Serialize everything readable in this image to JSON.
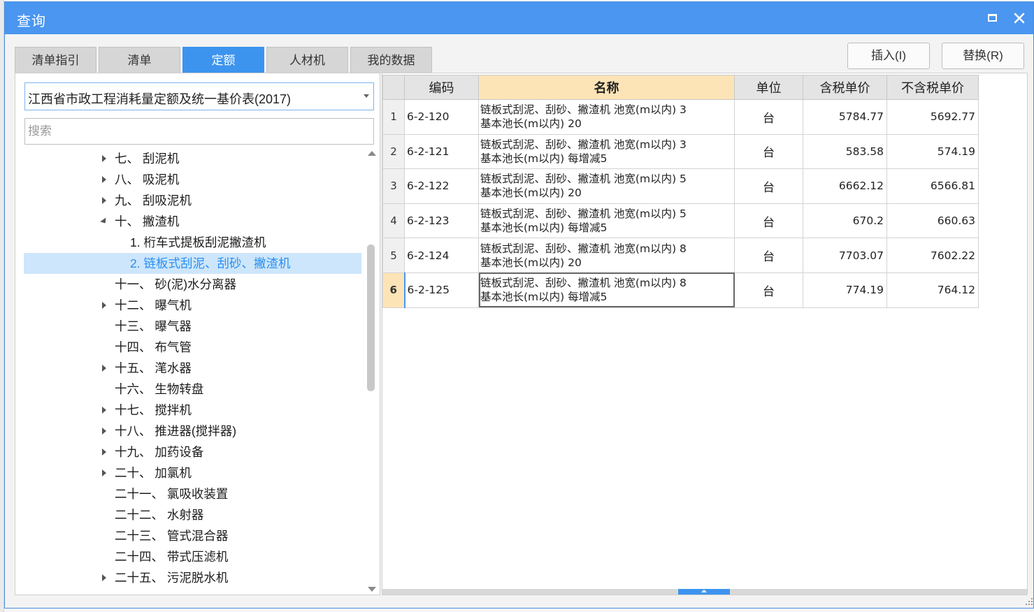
{
  "window": {
    "title": "查询"
  },
  "tabs": [
    {
      "label": "清单指引",
      "active": false
    },
    {
      "label": "清单",
      "active": false
    },
    {
      "label": "定额",
      "active": true
    },
    {
      "label": "人材机",
      "active": false
    },
    {
      "label": "我的数据",
      "active": false
    }
  ],
  "actions": {
    "insert_label": "插入(I)",
    "replace_label": "替换(R)"
  },
  "library": {
    "selected": "江西省市政工程消耗量定额及统一基价表(2017)"
  },
  "search": {
    "placeholder": "搜索",
    "value": ""
  },
  "tree": [
    {
      "label": "七、 刮泥机",
      "expandable": true,
      "expanded": false,
      "level": 0,
      "selected": false
    },
    {
      "label": "八、 吸泥机",
      "expandable": true,
      "expanded": false,
      "level": 0,
      "selected": false
    },
    {
      "label": "九、 刮吸泥机",
      "expandable": true,
      "expanded": false,
      "level": 0,
      "selected": false
    },
    {
      "label": "十、 撇渣机",
      "expandable": true,
      "expanded": true,
      "level": 0,
      "selected": false
    },
    {
      "label": "1. 桁车式提板刮泥撇渣机",
      "expandable": false,
      "expanded": false,
      "level": 1,
      "selected": false
    },
    {
      "label": "2. 链板式刮泥、刮砂、撇渣机",
      "expandable": false,
      "expanded": false,
      "level": 1,
      "selected": true
    },
    {
      "label": "十一、 砂(泥)水分离器",
      "expandable": false,
      "expanded": false,
      "level": 0,
      "selected": false
    },
    {
      "label": "十二、 曝气机",
      "expandable": true,
      "expanded": false,
      "level": 0,
      "selected": false
    },
    {
      "label": "十三、 曝气器",
      "expandable": false,
      "expanded": false,
      "level": 0,
      "selected": false
    },
    {
      "label": "十四、 布气管",
      "expandable": false,
      "expanded": false,
      "level": 0,
      "selected": false
    },
    {
      "label": "十五、 滗水器",
      "expandable": true,
      "expanded": false,
      "level": 0,
      "selected": false
    },
    {
      "label": "十六、 生物转盘",
      "expandable": false,
      "expanded": false,
      "level": 0,
      "selected": false
    },
    {
      "label": "十七、 搅拌机",
      "expandable": true,
      "expanded": false,
      "level": 0,
      "selected": false
    },
    {
      "label": "十八、 推进器(搅拌器)",
      "expandable": true,
      "expanded": false,
      "level": 0,
      "selected": false
    },
    {
      "label": "十九、 加药设备",
      "expandable": true,
      "expanded": false,
      "level": 0,
      "selected": false
    },
    {
      "label": "二十、 加氯机",
      "expandable": true,
      "expanded": false,
      "level": 0,
      "selected": false
    },
    {
      "label": "二十一、 氯吸收装置",
      "expandable": false,
      "expanded": false,
      "level": 0,
      "selected": false
    },
    {
      "label": "二十二、 水射器",
      "expandable": false,
      "expanded": false,
      "level": 0,
      "selected": false
    },
    {
      "label": "二十三、 管式混合器",
      "expandable": false,
      "expanded": false,
      "level": 0,
      "selected": false
    },
    {
      "label": "二十四、 带式压滤机",
      "expandable": false,
      "expanded": false,
      "level": 0,
      "selected": false
    },
    {
      "label": "二十五、 污泥脱水机",
      "expandable": true,
      "expanded": false,
      "level": 0,
      "selected": false
    }
  ],
  "grid": {
    "columns": [
      "",
      "编码",
      "名称",
      "单位",
      "含税单价",
      "不含税单价"
    ],
    "active_row": 6,
    "rows": [
      {
        "no": "1",
        "code": "6-2-120",
        "name_line1": "链板式刮泥、刮砂、撇渣机 池宽(m以内) 3",
        "name_line2": "基本池长(m以内) 20",
        "unit": "台",
        "price_tax": "5784.77",
        "price_notax": "5692.77"
      },
      {
        "no": "2",
        "code": "6-2-121",
        "name_line1": "链板式刮泥、刮砂、撇渣机 池宽(m以内) 3",
        "name_line2": "基本池长(m以内) 每增减5",
        "unit": "台",
        "price_tax": "583.58",
        "price_notax": "574.19"
      },
      {
        "no": "3",
        "code": "6-2-122",
        "name_line1": "链板式刮泥、刮砂、撇渣机 池宽(m以内) 5",
        "name_line2": "基本池长(m以内) 20",
        "unit": "台",
        "price_tax": "6662.12",
        "price_notax": "6566.81"
      },
      {
        "no": "4",
        "code": "6-2-123",
        "name_line1": "链板式刮泥、刮砂、撇渣机 池宽(m以内) 5",
        "name_line2": "基本池长(m以内) 每增减5",
        "unit": "台",
        "price_tax": "670.2",
        "price_notax": "660.63"
      },
      {
        "no": "5",
        "code": "6-2-124",
        "name_line1": "链板式刮泥、刮砂、撇渣机 池宽(m以内) 8",
        "name_line2": "基本池长(m以内) 20",
        "unit": "台",
        "price_tax": "7703.07",
        "price_notax": "7602.22"
      },
      {
        "no": "6",
        "code": "6-2-125",
        "name_line1": "链板式刮泥、刮砂、撇渣机 池宽(m以内) 8",
        "name_line2": "基本池长(m以内) 每增减5",
        "unit": "台",
        "price_tax": "774.19",
        "price_notax": "764.12"
      }
    ]
  },
  "colors": {
    "titlebar": "#4a96f0",
    "active_tab": "#3d94ef",
    "selected_tree_bg": "#cde6fb",
    "name_header_bg": "#fde4b7"
  }
}
